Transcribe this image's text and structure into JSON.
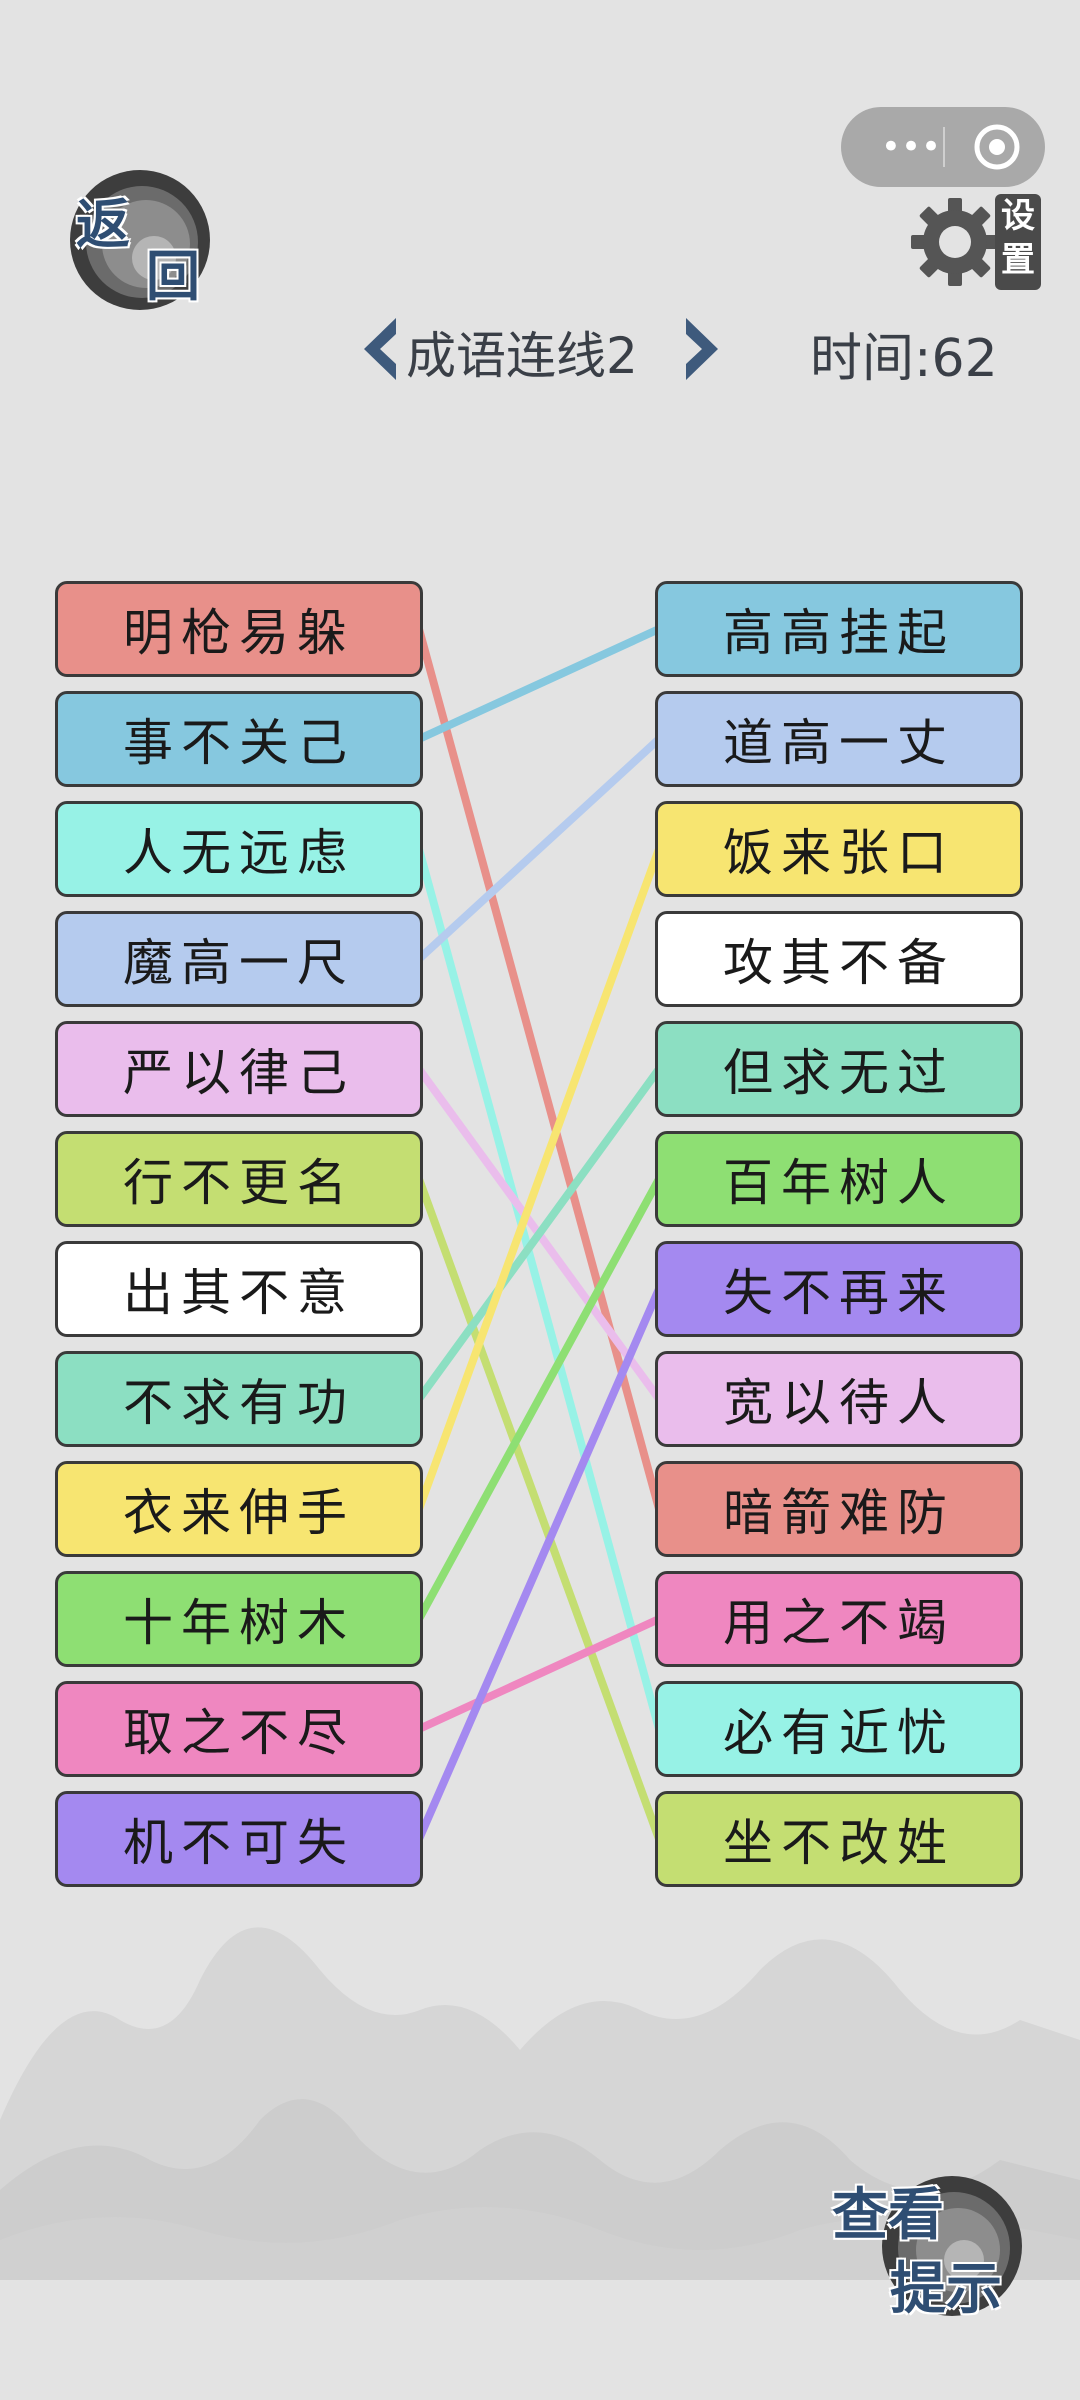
{
  "header": {
    "back_label_1": "返",
    "back_label_2": "回",
    "settings_label_1": "设",
    "settings_label_2": "置",
    "level_title": "成语连线2",
    "timer_text": "时间:62",
    "capsule_more": "•••"
  },
  "left_items": [
    {
      "text": "明枪易躲",
      "color": "#e8908a"
    },
    {
      "text": "事不关己",
      "color": "#86c8df"
    },
    {
      "text": "人无远虑",
      "color": "#97f2e6"
    },
    {
      "text": "魔高一尺",
      "color": "#b5cbee"
    },
    {
      "text": "严以律己",
      "color": "#eabdec"
    },
    {
      "text": "行不更名",
      "color": "#c4de72"
    },
    {
      "text": "出其不意",
      "color": "#ffffff"
    },
    {
      "text": "不求有功",
      "color": "#8cdfc2"
    },
    {
      "text": "衣来伸手",
      "color": "#f7e571"
    },
    {
      "text": "十年树木",
      "color": "#8edf73"
    },
    {
      "text": "取之不尽",
      "color": "#ef87c0"
    },
    {
      "text": "机不可失",
      "color": "#a489f0"
    }
  ],
  "right_items": [
    {
      "text": "高高挂起",
      "color": "#86c8df"
    },
    {
      "text": "道高一丈",
      "color": "#b5cbee"
    },
    {
      "text": "饭来张口",
      "color": "#f7e571"
    },
    {
      "text": "攻其不备",
      "color": "#ffffff"
    },
    {
      "text": "但求无过",
      "color": "#8cdfc2"
    },
    {
      "text": "百年树人",
      "color": "#8edf73"
    },
    {
      "text": "失不再来",
      "color": "#a489f0"
    },
    {
      "text": "宽以待人",
      "color": "#eabdec"
    },
    {
      "text": "暗箭难防",
      "color": "#e8908a"
    },
    {
      "text": "用之不竭",
      "color": "#ef87c0"
    },
    {
      "text": "必有近忧",
      "color": "#97f2e6"
    },
    {
      "text": "坐不改姓",
      "color": "#c4de72"
    }
  ],
  "connections": [
    {
      "from": 0,
      "to": 8,
      "color": "#e8908a"
    },
    {
      "from": 1,
      "to": 0,
      "color": "#86c8df"
    },
    {
      "from": 2,
      "to": 10,
      "color": "#97f2e6"
    },
    {
      "from": 3,
      "to": 1,
      "color": "#b5cbee"
    },
    {
      "from": 4,
      "to": 7,
      "color": "#eabdec"
    },
    {
      "from": 5,
      "to": 11,
      "color": "#c4de72"
    },
    {
      "from": 7,
      "to": 4,
      "color": "#8cdfc2"
    },
    {
      "from": 8,
      "to": 2,
      "color": "#f7e571"
    },
    {
      "from": 9,
      "to": 5,
      "color": "#8edf73"
    },
    {
      "from": 10,
      "to": 9,
      "color": "#ef87c0"
    },
    {
      "from": 11,
      "to": 6,
      "color": "#a489f0"
    }
  ],
  "footer": {
    "hint_label_1": "查看",
    "hint_label_2": "提示"
  }
}
